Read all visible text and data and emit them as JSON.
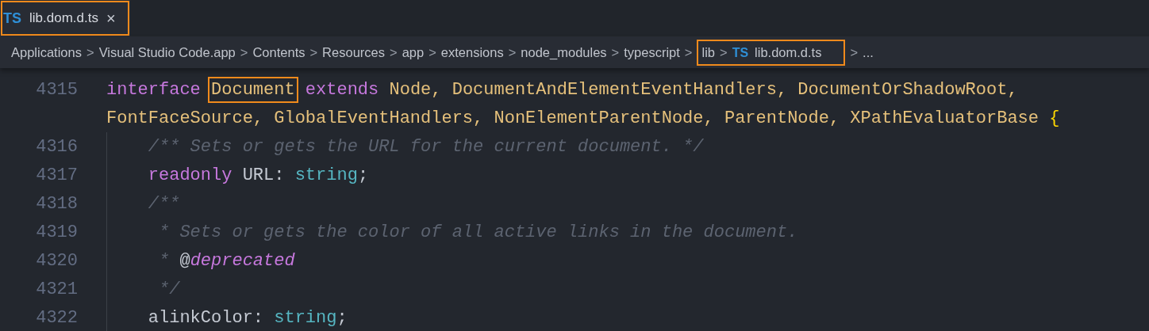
{
  "tabs": [
    {
      "icon": "TS",
      "label": "lib.dom.d.ts",
      "close": "×",
      "selected": true,
      "highlighted": true
    }
  ],
  "breadcrumb": {
    "items": [
      {
        "label": "Applications",
        "highlighted": false
      },
      {
        "label": "Visual Studio Code.app",
        "highlighted": false
      },
      {
        "label": "Contents",
        "highlighted": false
      },
      {
        "label": "Resources",
        "highlighted": false
      },
      {
        "label": "app",
        "highlighted": false
      },
      {
        "label": "extensions",
        "highlighted": false
      },
      {
        "label": "node_modules",
        "highlighted": false
      },
      {
        "label": "typescript",
        "highlighted": false
      },
      {
        "label": "lib",
        "highlighted": true
      },
      {
        "label": "lib.dom.d.ts",
        "icon": "TS",
        "highlighted": true
      }
    ],
    "separator": ">",
    "more": "..."
  },
  "code": [
    {
      "number": "4315",
      "tokens": [
        {
          "kind": "keyword",
          "text": "interface "
        },
        {
          "kind": "type",
          "text": "Document",
          "highlighted": true
        },
        {
          "kind": "keyword",
          "text": " extends "
        },
        {
          "kind": "type",
          "text": "Node, DocumentAndElementEventHandlers, DocumentOrShadowRoot,"
        }
      ]
    },
    {
      "tokens": [
        {
          "kind": "type",
          "text": "FontFaceSource, GlobalEventHandlers, NonElementParentNode, ParentNode, XPathEvaluatorBase "
        },
        {
          "kind": "brace",
          "text": "{"
        }
      ]
    },
    {
      "number": "4316",
      "tokens": [
        {
          "kind": "comment",
          "text": "    /** Sets or gets the URL for the current document. */"
        }
      ]
    },
    {
      "number": "4317",
      "tokens": [
        {
          "kind": "keyword",
          "text": "    readonly"
        },
        {
          "kind": "plain",
          "text": " URL: "
        },
        {
          "kind": "builtin",
          "text": "string"
        },
        {
          "kind": "plain",
          "text": ";"
        }
      ]
    },
    {
      "number": "4318",
      "tokens": [
        {
          "kind": "comment",
          "text": "    /**"
        }
      ]
    },
    {
      "number": "4319",
      "tokens": [
        {
          "kind": "comment",
          "text": "     * Sets or gets the color of all active links in the document."
        }
      ]
    },
    {
      "number": "4320",
      "tokens": [
        {
          "kind": "comment",
          "text": "     * "
        },
        {
          "kind": "plain",
          "text": "@"
        },
        {
          "kind": "tag",
          "text": "deprecated"
        }
      ]
    },
    {
      "number": "4321",
      "tokens": [
        {
          "kind": "comment",
          "text": "     */"
        }
      ]
    },
    {
      "number": "4322",
      "tokens": [
        {
          "kind": "plain",
          "text": "    alinkColor: "
        },
        {
          "kind": "builtin",
          "text": "string"
        },
        {
          "kind": "plain",
          "text": ";"
        }
      ]
    }
  ]
}
